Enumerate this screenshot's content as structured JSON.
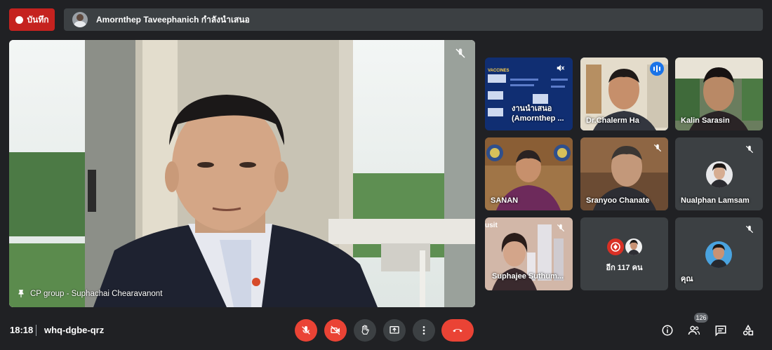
{
  "topbar": {
    "record_label": "บันทึก",
    "presenting_banner": "Amornthep Taveephanich กำลังนำเสนอ"
  },
  "main_tile": {
    "name": "CP group - Suphachai Chearavanont"
  },
  "tiles": [
    {
      "name": "งานนำเสนอ (Amornthep ..."
    },
    {
      "name": "Dr.Chalerm Ha"
    },
    {
      "name": "Kalin Sarasin"
    },
    {
      "name": "SANAN"
    },
    {
      "name": "Sranyoo Chanate"
    },
    {
      "name": "Nualphan Lamsam"
    },
    {
      "name": "Suphajee Suthum..."
    },
    {
      "name": "อีก 117 คน"
    },
    {
      "name": "คุณ"
    }
  ],
  "slide_thumb": {
    "heading": "VACCINES",
    "corner_logo": "usit"
  },
  "bottombar": {
    "time": "18:18",
    "meeting_code": "whq-dgbe-qrz",
    "participants_count": "126"
  },
  "colors": {
    "background": "#202124",
    "tile": "#3c4043",
    "danger": "#ea4335",
    "record": "#c5221f",
    "speaking": "#1a73e8"
  }
}
